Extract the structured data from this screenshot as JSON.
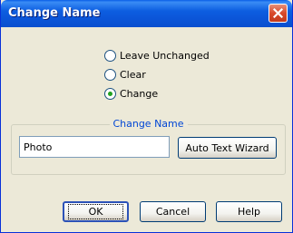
{
  "window": {
    "title": "Change Name"
  },
  "options": [
    {
      "label": "Leave Unchanged",
      "checked": false
    },
    {
      "label": "Clear",
      "checked": false
    },
    {
      "label": "Change",
      "checked": true
    }
  ],
  "group": {
    "label": "Change Name",
    "input_value": "Photo",
    "wizard_button": "Auto Text Wizard"
  },
  "buttons": {
    "ok": "OK",
    "cancel": "Cancel",
    "help": "Help"
  },
  "icons": {
    "close": "close-icon"
  },
  "colors": {
    "titlebar": "#0b55d8",
    "dialog_bg": "#ece9d8",
    "group_label": "#0046d5",
    "radio_dot": "#21a121",
    "close_button": "#d9492a"
  }
}
